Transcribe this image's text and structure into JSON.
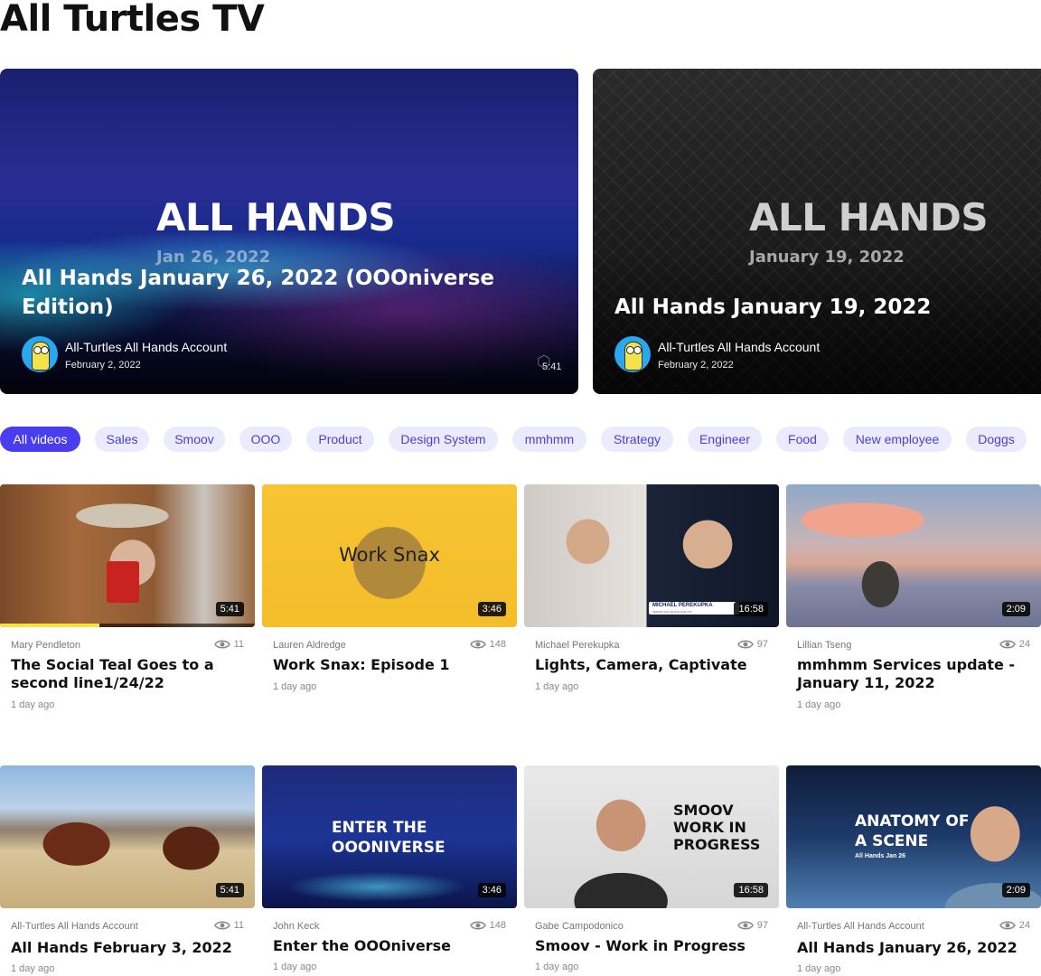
{
  "page": {
    "title": "All Turtles TV"
  },
  "featured": [
    {
      "big_text": "ALL HANDS",
      "date_text": "Jan 26, 2022",
      "title": "All Hands January 26, 2022 (OOOniverse Edition)",
      "author": "All-Turtles All Hands Account",
      "posted": "February 2, 2022",
      "duration": "5:41"
    },
    {
      "big_text": "ALL HANDS",
      "date_text": "January 19, 2022",
      "title": "All Hands January 19, 2022",
      "author": "All-Turtles All Hands Account",
      "posted": "February 2, 2022"
    }
  ],
  "filters": [
    "All videos",
    "Sales",
    "Smoov",
    "OOO",
    "Product",
    "Design System",
    "mmhmm",
    "Strategy",
    "Engineer",
    "Food",
    "New employee",
    "Doggs"
  ],
  "active_filter": "All videos",
  "videos": [
    {
      "author": "Mary Pendleton",
      "views": "11",
      "title": "The Social Teal Goes to a second line1/24/22",
      "age": "1 day ago",
      "duration": "5:41",
      "progress": 0.39
    },
    {
      "author": "Lauren Aldredge",
      "views": "148",
      "title": "Work Snax: Episode 1",
      "age": "1 day ago",
      "duration": "3:46",
      "overlay": "Work Snax"
    },
    {
      "author": "Michael Perekupka",
      "views": "97",
      "title": "Lights, Camera, Captivate",
      "age": "1 day ago",
      "duration": "16:58",
      "overlay": "MICHAEL PEREKUPKA",
      "overlay_sub": "SENIOR SOLUTIONS ANALYST"
    },
    {
      "author": "Lillian Tseng",
      "views": "24",
      "title": "mmhmm Services update - January 11, 2022",
      "age": "1 day ago",
      "duration": "2:09"
    },
    {
      "author": "All-Turtles All Hands Account",
      "views": "11",
      "title": "All Hands February 3, 2022",
      "age": "1 day ago",
      "duration": "5:41"
    },
    {
      "author": "John Keck",
      "views": "148",
      "title": "Enter the OOOniverse",
      "age": "1 day ago",
      "duration": "3:46",
      "overlay": "ENTER THE OOONIVERSE"
    },
    {
      "author": "Gabe Campodonico",
      "views": "97",
      "title": "Smoov - Work in Progress",
      "age": "1 day ago",
      "duration": "16:58",
      "overlay": "SMOOV WORK IN PROGRESS"
    },
    {
      "author": "All-Turtles All Hands Account",
      "views": "24",
      "title": "All Hands January 26, 2022",
      "age": "1 day ago",
      "duration": "2:09",
      "overlay": "ANATOMY OF A SCENE",
      "overlay_sub": "All Hands Jan 26"
    }
  ],
  "colors": {
    "accent": "#4a3df0",
    "chip_bg": "#ecebfd",
    "chip_text": "#4b3fd6",
    "progress": "#f7e23e"
  },
  "icons": {
    "views": "eye-icon",
    "avatar": "turtle-avatar"
  }
}
